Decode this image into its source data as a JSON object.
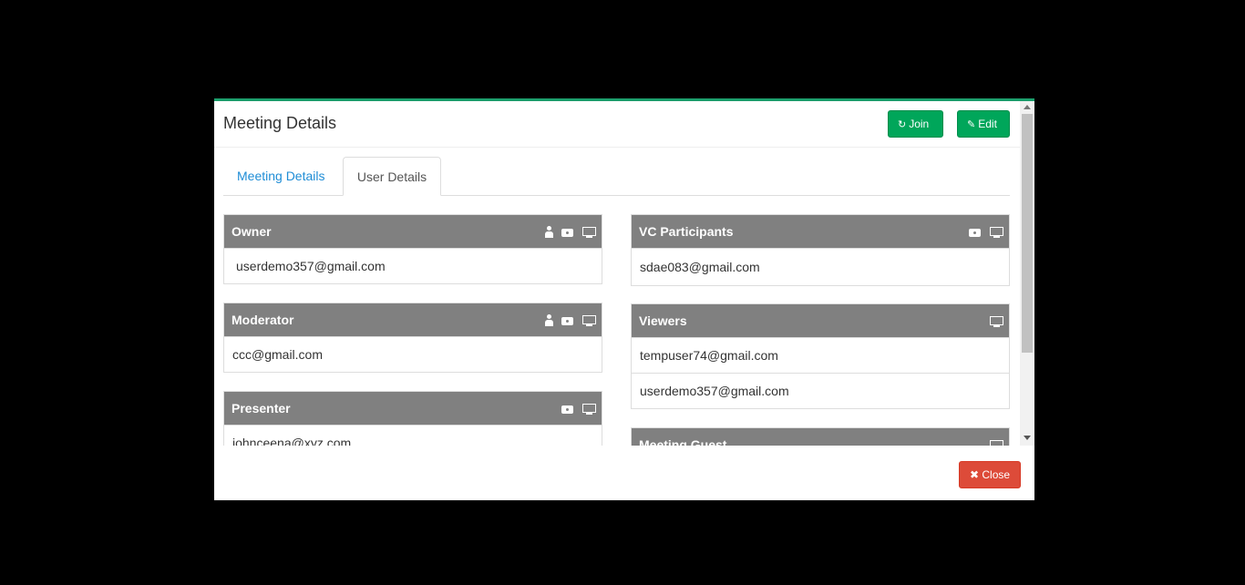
{
  "modal": {
    "title": "Meeting Details",
    "join_label": "Join",
    "edit_label": "Edit",
    "close_label": "Close"
  },
  "tabs": [
    {
      "label": "Meeting Details",
      "active": false
    },
    {
      "label": "User Details",
      "active": true
    }
  ],
  "panels": {
    "owner": {
      "title": "Owner",
      "icons": [
        "user-icon",
        "camera-icon",
        "monitor-icon"
      ],
      "users": [
        "userdemo357@gmail.com"
      ]
    },
    "moderator": {
      "title": "Moderator",
      "icons": [
        "user-icon",
        "camera-icon",
        "monitor-icon"
      ],
      "users": [
        "ccc@gmail.com"
      ]
    },
    "presenter": {
      "title": "Presenter",
      "icons": [
        "camera-icon",
        "monitor-icon"
      ],
      "users": [
        "johnceena@xyz.com"
      ]
    },
    "vc_participants": {
      "title": "VC Participants",
      "icons": [
        "camera-icon",
        "monitor-icon"
      ],
      "users": [
        "sdae083@gmail.com"
      ]
    },
    "viewers": {
      "title": "Viewers",
      "icons": [
        "monitor-icon"
      ],
      "users": [
        "tempuser74@gmail.com",
        "userdemo357@gmail.com"
      ]
    },
    "meeting_guest": {
      "title": "Meeting Guest",
      "icons": [
        "monitor-icon"
      ],
      "users": []
    }
  },
  "colors": {
    "accent": "#1a9d6b",
    "button_green": "#00a65a",
    "button_red": "#dd4b39",
    "panel_header": "#808080",
    "tab_link": "#1f8dd6"
  }
}
